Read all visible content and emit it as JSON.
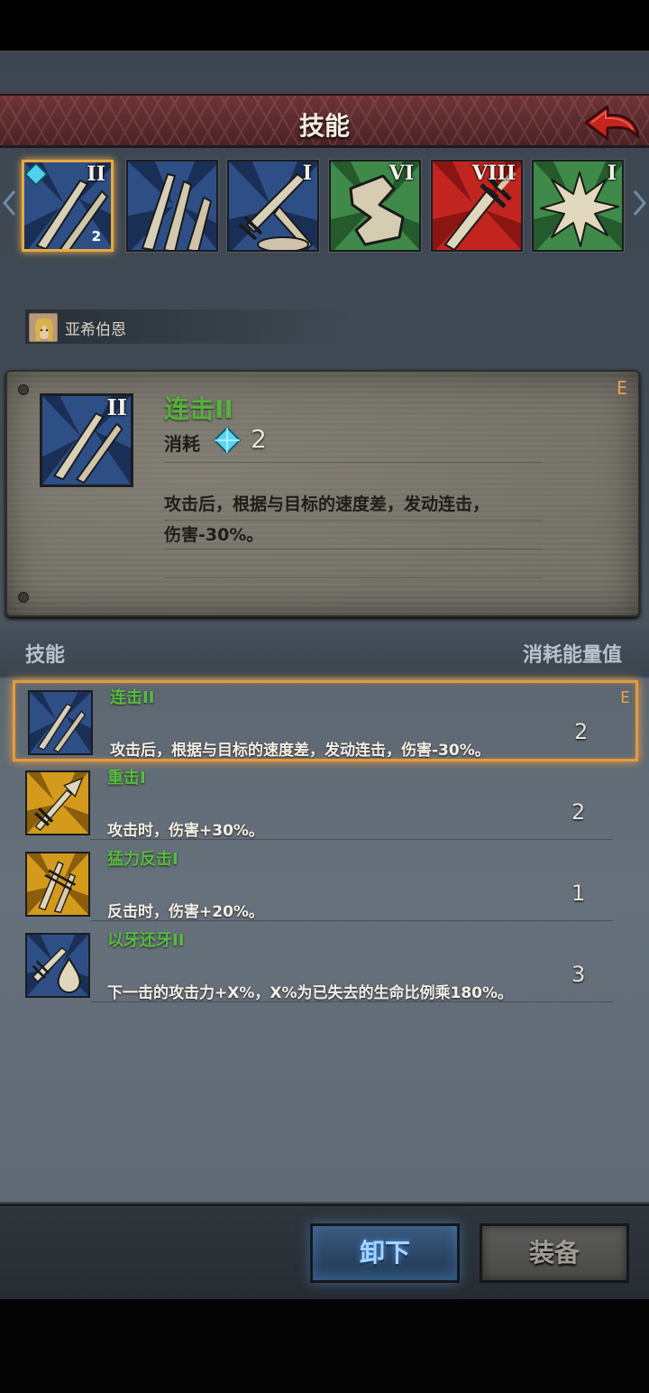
{
  "header": {
    "title": "技能"
  },
  "strip_skills": [
    {
      "icon": "twin-blades-icon",
      "roman": "II",
      "cost_badge": "2",
      "color": "#2e4f86",
      "selected": true
    },
    {
      "icon": "triple-slash-icon",
      "roman": "",
      "color": "#2e4f86"
    },
    {
      "icon": "crossed-swords-icon",
      "roman": "I",
      "color": "#2e4f86"
    },
    {
      "icon": "armored-arm-icon",
      "roman": "VI",
      "color": "#3f8a48"
    },
    {
      "icon": "red-sword-icon",
      "roman": "VIII",
      "color": "#c2251f"
    },
    {
      "icon": "burst-star-icon",
      "roman": "I",
      "color": "#3f8a48"
    }
  ],
  "hero": {
    "name": "亚希伯恩"
  },
  "detail": {
    "name": "连击II",
    "roman": "II",
    "cost_label": "消耗",
    "cost_value": "2",
    "grade": "E",
    "desc_line1": "攻击后，根据与目标的速度差，发动连击，",
    "desc_line2": "伤害-30%。"
  },
  "list_header": {
    "left": "技能",
    "right": "消耗能量值"
  },
  "skills": [
    {
      "name": "连击II",
      "desc": "攻击后，根据与目标的速度差，发动连击，伤害-30%。",
      "cost": "2",
      "grade": "E",
      "icon": "twin-blades-icon",
      "color": "#2e4f86",
      "selected": true
    },
    {
      "name": "重击I",
      "desc": "攻击时，伤害+30%。",
      "cost": "2",
      "icon": "sword-arrow-icon",
      "color": "#d39a1c"
    },
    {
      "name": "猛力反击I",
      "desc": "反击时，伤害+20%。",
      "cost": "1",
      "icon": "counter-blades-icon",
      "color": "#d39a1c"
    },
    {
      "name": "以牙还牙II",
      "desc": "下一击的攻击力+X%，X%为已失去的生命比例乘180%。",
      "cost": "3",
      "icon": "sword-drop-icon",
      "color": "#2e4f86"
    }
  ],
  "buttons": {
    "unequip": "卸下",
    "equip": "装备"
  }
}
